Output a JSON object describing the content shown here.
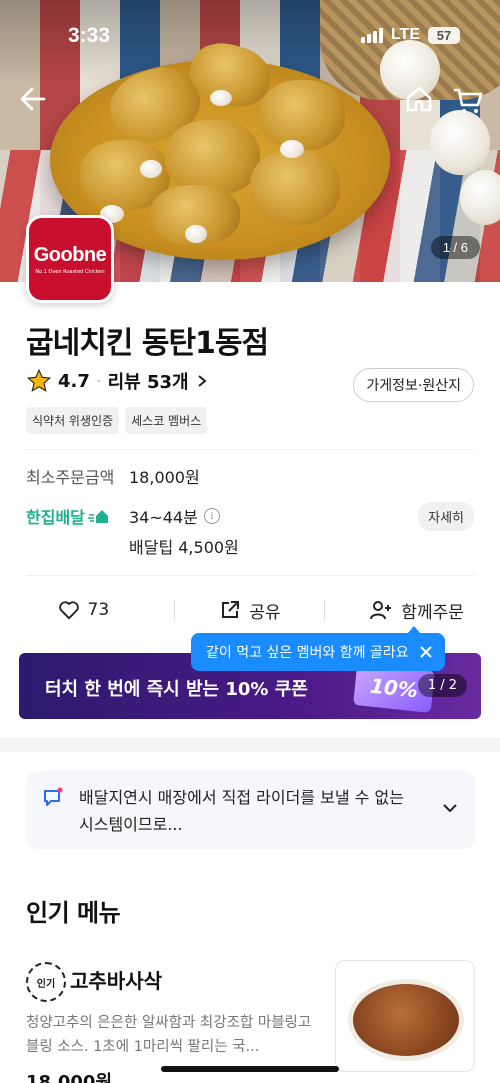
{
  "status_bar": {
    "time": "3:33",
    "network": "LTE",
    "battery": "57"
  },
  "hero": {
    "page_indicator": "1 / 6"
  },
  "store": {
    "logo_text": "Goobne",
    "logo_subtext": "No.1 Oven Roasted Chicken",
    "name": "굽네치킨 동탄1동점",
    "rating": "4.7",
    "reviews": "리뷰 53개",
    "info_button": "가게정보·원산지",
    "badges": [
      "식약처 위생인증",
      "세스코 멤버스"
    ]
  },
  "delivery": {
    "min_order_label": "최소주문금액",
    "min_order_value": "18,000원",
    "type_label": "한집배달",
    "time": "34~44분",
    "detail_button": "자세히",
    "tip": "배달팁 4,500원"
  },
  "actions": {
    "like_count": "73",
    "share_label": "공유",
    "group_order_label": "함께주문"
  },
  "tooltip": {
    "text": "같이 먹고 싶은 멤버와 함께 골라요"
  },
  "coupon": {
    "text": "터치 한 번에 즉시 받는 10% 쿠폰",
    "ticket": "10%",
    "pager": "1 / 2"
  },
  "notice": {
    "text": "배달지연시 매장에서 직접 라이더를 보낼 수 없는 시스템이므로..."
  },
  "menu": {
    "section_title": "인기 메뉴",
    "items": [
      {
        "badge": "인기",
        "name": "고추바사삭",
        "description": "청양고추의 은은한 알싸함과 최강조합 마블링고블링 소스. 1초에 1마리씩 팔리는 국...",
        "price": "18,000원"
      }
    ]
  },
  "colors": {
    "brand_red": "#c8102e",
    "hanjip_green": "#1fb08e",
    "tooltip_blue": "#1a8cff",
    "coupon_purple": "#4b1a86"
  }
}
